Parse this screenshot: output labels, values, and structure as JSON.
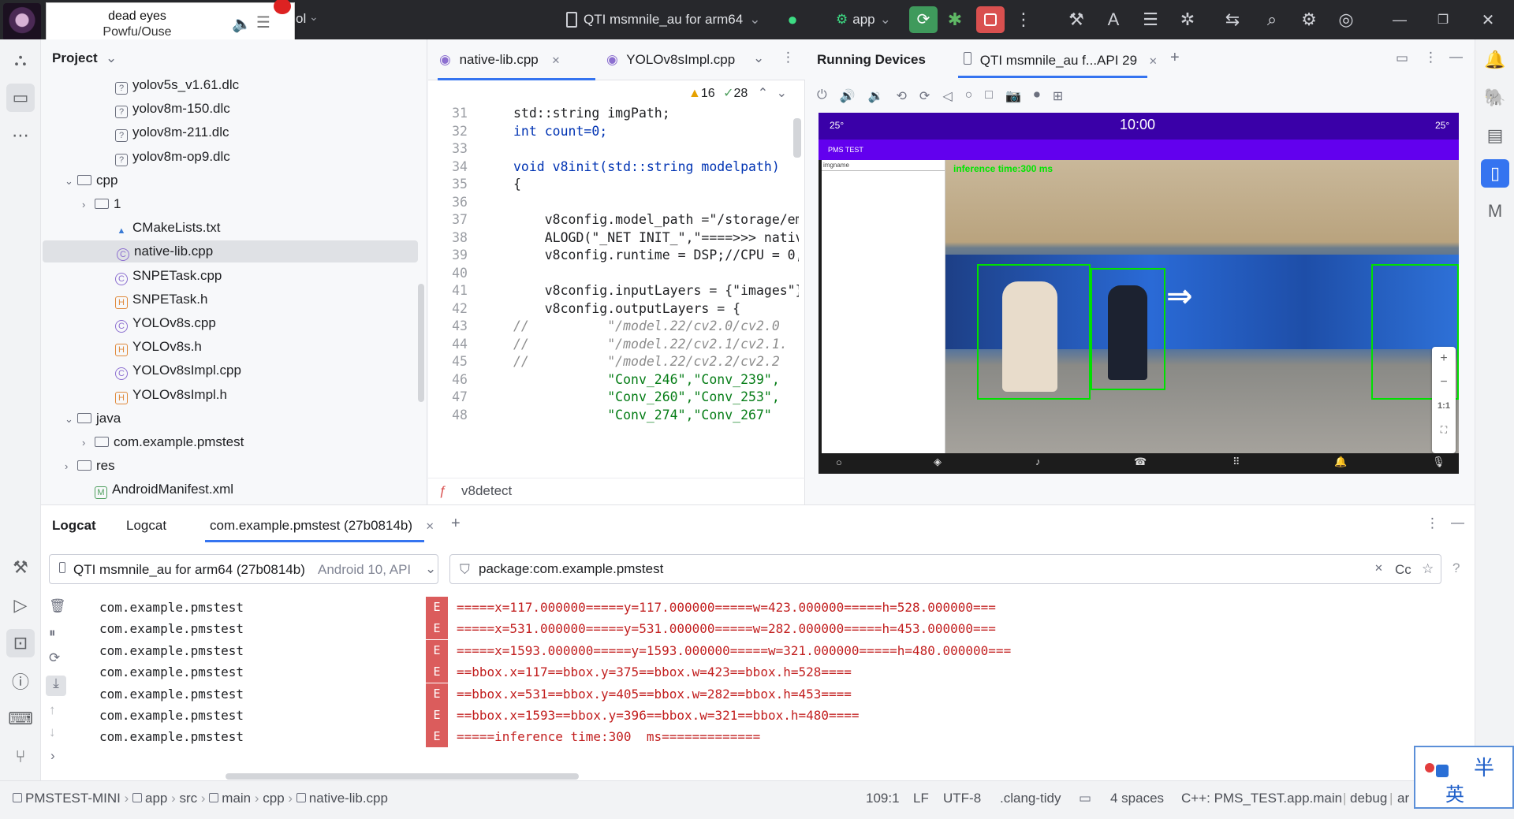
{
  "titlebar": {
    "project_fragment": "ol",
    "device_selector": "QTI msmnile_au for arm64",
    "run_config": "app"
  },
  "media": {
    "track": "dead eyes",
    "artist": "Powfu/Ouse"
  },
  "project_panel": {
    "title": "Project",
    "items": [
      {
        "label": "yolov5s_v1.61.dlc",
        "kind": "file-unknown"
      },
      {
        "label": "yolov8m-150.dlc",
        "kind": "file-unknown"
      },
      {
        "label": "yolov8m-211.dlc",
        "kind": "file-unknown"
      },
      {
        "label": "yolov8m-op9.dlc",
        "kind": "file-unknown"
      },
      {
        "label": "cpp",
        "kind": "folder-open"
      },
      {
        "label": "1",
        "kind": "folder-closed"
      },
      {
        "label": "CMakeLists.txt",
        "kind": "cmake"
      },
      {
        "label": "native-lib.cpp",
        "kind": "cpp",
        "selected": true
      },
      {
        "label": "SNPETask.cpp",
        "kind": "cpp"
      },
      {
        "label": "SNPETask.h",
        "kind": "h"
      },
      {
        "label": "YOLOv8s.cpp",
        "kind": "cpp"
      },
      {
        "label": "YOLOv8s.h",
        "kind": "h"
      },
      {
        "label": "YOLOv8sImpl.cpp",
        "kind": "cpp"
      },
      {
        "label": "YOLOv8sImpl.h",
        "kind": "h"
      },
      {
        "label": "java",
        "kind": "folder-open"
      },
      {
        "label": "com.example.pmstest",
        "kind": "package"
      },
      {
        "label": "res",
        "kind": "folder-closed"
      },
      {
        "label": "AndroidManifest.xml",
        "kind": "manifest"
      }
    ]
  },
  "editor": {
    "tabs": [
      "native-lib.cpp",
      "YOLOv8sImpl.cpp"
    ],
    "inspection": {
      "warnings": "16",
      "ok": "28"
    },
    "breadcrumb": "v8detect",
    "lines": [
      {
        "n": "31",
        "text": "std::string imgPath;"
      },
      {
        "n": "32",
        "text": "int count=0;"
      },
      {
        "n": "33",
        "text": ""
      },
      {
        "n": "34",
        "text": "void v8init(std::string modelpath)"
      },
      {
        "n": "35",
        "text": "{"
      },
      {
        "n": "36",
        "text": ""
      },
      {
        "n": "37",
        "text": "    v8config.model_path =\"/storage/em"
      },
      {
        "n": "38",
        "text": "    ALOGD(\"_NET INIT_\",\"====>>> nativ"
      },
      {
        "n": "39",
        "text": "    v8config.runtime = DSP;//CPU = 0,"
      },
      {
        "n": "40",
        "text": ""
      },
      {
        "n": "41",
        "text": "    v8config.inputLayers = {\"images\"}"
      },
      {
        "n": "42",
        "text": "    v8config.outputLayers = {"
      },
      {
        "n": "43",
        "text": "//          \"/model.22/cv2.0/cv2.0"
      },
      {
        "n": "44",
        "text": "//          \"/model.22/cv2.1/cv2.1."
      },
      {
        "n": "45",
        "text": "//          \"/model.22/cv2.2/cv2.2"
      },
      {
        "n": "46",
        "text": "            \"Conv_246\",\"Conv_239\","
      },
      {
        "n": "47",
        "text": "            \"Conv_260\",\"Conv_253\","
      },
      {
        "n": "48",
        "text": "            \"Conv_274\",\"Conv_267\""
      }
    ]
  },
  "devices": {
    "title": "Running Devices",
    "tab": "QTI msmnile_au f...API 29",
    "phone": {
      "status_left": "25°",
      "clock": "10:00",
      "status_right": "25°",
      "app_title": "PMS TEST",
      "side_label": "imgname",
      "overlay_text": "inference time:300 ms",
      "zoom_label": "1:1"
    }
  },
  "logcat": {
    "tabs": [
      "Logcat",
      "Logcat",
      "com.example.pmstest (27b0814b)"
    ],
    "device": "QTI msmnile_au for arm64 (27b0814b)",
    "device_suffix": "Android 10, API",
    "filter": "package:com.example.pmstest",
    "filter_case": "Cc",
    "rows": [
      {
        "pkg": "com.example.pmstest",
        "level": "E",
        "msg": "=====x=117.000000=====y=117.000000=====w=423.000000=====h=528.000000==="
      },
      {
        "pkg": "com.example.pmstest",
        "level": "E",
        "msg": "=====x=531.000000=====y=531.000000=====w=282.000000=====h=453.000000==="
      },
      {
        "pkg": "com.example.pmstest",
        "level": "E",
        "msg": "=====x=1593.000000=====y=1593.000000=====w=321.000000=====h=480.000000==="
      },
      {
        "pkg": "com.example.pmstest",
        "level": "E",
        "msg": "==bbox.x=117==bbox.y=375==bbox.w=423==bbox.h=528===="
      },
      {
        "pkg": "com.example.pmstest",
        "level": "E",
        "msg": "==bbox.x=531==bbox.y=405==bbox.w=282==bbox.h=453===="
      },
      {
        "pkg": "com.example.pmstest",
        "level": "E",
        "msg": "==bbox.x=1593==bbox.y=396==bbox.w=321==bbox.h=480===="
      },
      {
        "pkg": "com.example.pmstest",
        "level": "E",
        "msg": "=====inference time:300  ms============="
      }
    ]
  },
  "statusbar": {
    "crumbs": [
      "PMSTEST-MINI",
      "app",
      "src",
      "main",
      "cpp",
      "native-lib.cpp"
    ],
    "position": "109:1",
    "line_sep": "LF",
    "encoding": "UTF-8",
    "linter": ".clang-tidy",
    "indent": "4 spaces",
    "context": "C++: PMS_TEST.app.main",
    "build": "debug",
    "overflow": "ar"
  },
  "ime": {
    "mode_char": "半",
    "lang_char": "英"
  }
}
